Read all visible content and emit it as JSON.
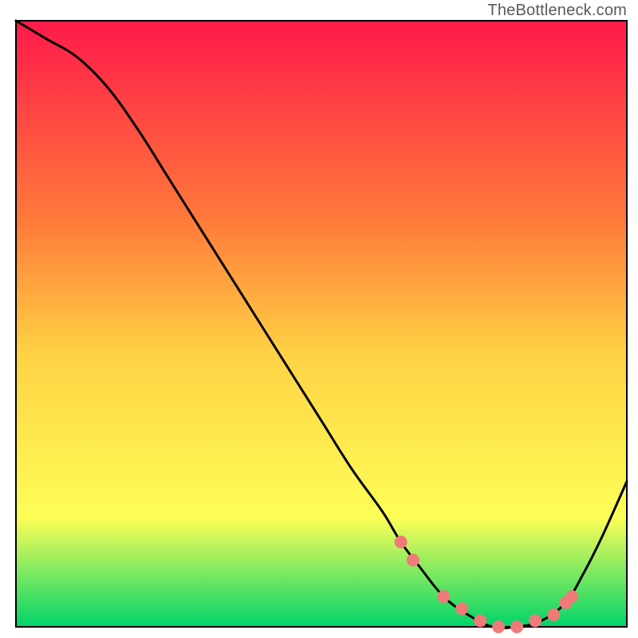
{
  "watermark": "TheBottleneck.com",
  "colors": {
    "grad_top": "#ff1a4b",
    "grad_mid_upper": "#ff7a3a",
    "grad_mid": "#ffd244",
    "grad_mid_lower": "#fdfe57",
    "grad_bottom": "#00d46a",
    "frame": "#000000",
    "curve": "#000000",
    "dot": "#f07a78"
  },
  "chart_data": {
    "type": "line",
    "title": "",
    "xlabel": "",
    "ylabel": "",
    "xlim": [
      0,
      100
    ],
    "ylim": [
      0,
      100
    ],
    "legend": false,
    "grid": false,
    "series": [
      {
        "name": "bottleneck-curve",
        "x": [
          0,
          5,
          10,
          15,
          20,
          25,
          30,
          35,
          40,
          45,
          50,
          55,
          60,
          63,
          66,
          70,
          74,
          78,
          82,
          86,
          90,
          93,
          96,
          100
        ],
        "y": [
          100,
          97,
          94,
          89,
          82,
          74,
          66,
          58,
          50,
          42,
          34,
          26,
          19,
          14,
          10,
          5,
          2,
          0,
          0,
          1,
          4,
          9,
          15,
          24
        ]
      }
    ],
    "markers": {
      "name": "highlight-dots",
      "x": [
        63,
        65,
        70,
        73,
        76,
        79,
        82,
        85,
        88,
        90,
        91
      ],
      "y": [
        14,
        11,
        5,
        3,
        1,
        0,
        0,
        1,
        2,
        4,
        5
      ]
    }
  }
}
